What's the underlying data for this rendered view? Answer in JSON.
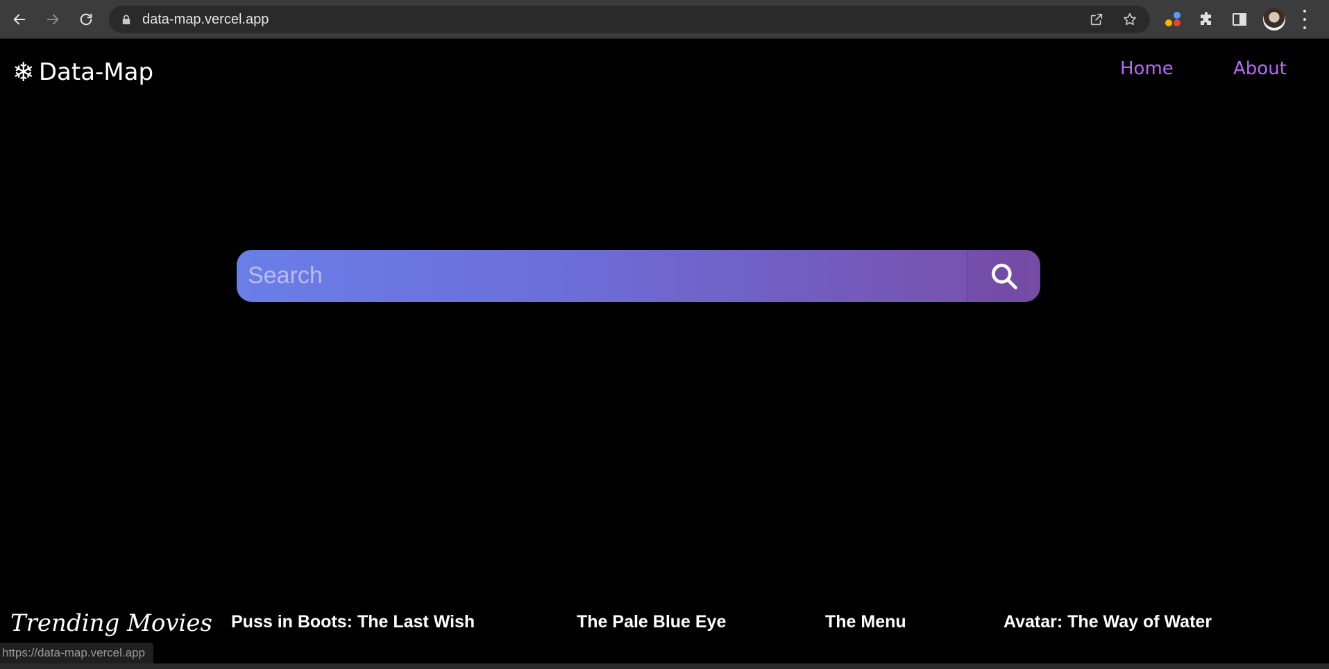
{
  "browser": {
    "url": "data-map.vercel.app",
    "status_url": "https://data-map.vercel.app"
  },
  "header": {
    "logo_glyph": "❄",
    "brand": "Data-Map",
    "nav": [
      {
        "label": "Home"
      },
      {
        "label": "About"
      }
    ],
    "link_color": "#b967ff"
  },
  "search": {
    "placeholder": "Search",
    "gradient_start": "#6a7ee8",
    "gradient_end": "#7a4fa8"
  },
  "trending": {
    "title": "Trending Movies",
    "movies": [
      {
        "title": "Puss in Boots: The Last Wish"
      },
      {
        "title": "The Pale Blue Eye"
      },
      {
        "title": "The Menu"
      },
      {
        "title": "Avatar: The Way of Water"
      }
    ]
  }
}
